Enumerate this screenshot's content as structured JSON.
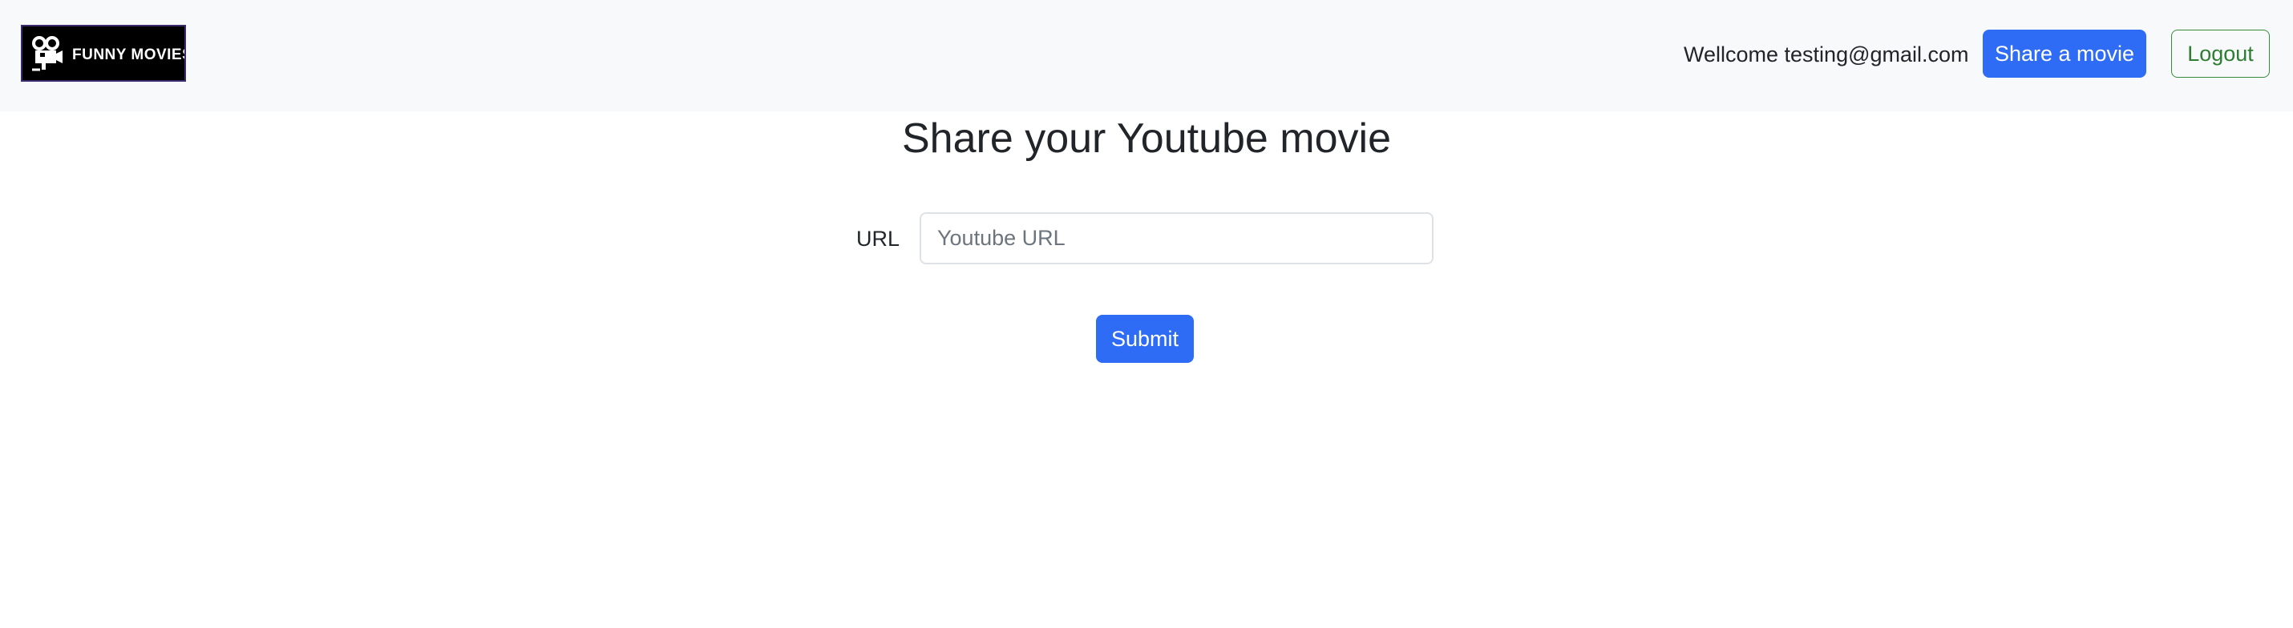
{
  "header": {
    "logo_text": "FUNNY MOVIES",
    "welcome_text": "Wellcome testing@gmail.com",
    "share_button_label": "Share a movie",
    "logout_button_label": "Logout"
  },
  "main": {
    "title": "Share your Youtube movie",
    "url_label": "URL",
    "url_placeholder": "Youtube URL",
    "url_value": "",
    "submit_label": "Submit"
  },
  "colors": {
    "navbar_bg": "#f8f9fa",
    "primary": "#2f6cf6",
    "logout_outline": "#2e7d32",
    "text": "#212529"
  },
  "icons": {
    "logo_icon": "film-camera-icon"
  }
}
